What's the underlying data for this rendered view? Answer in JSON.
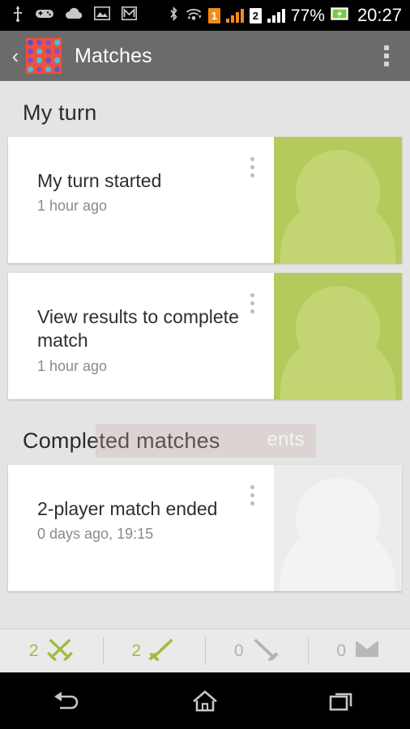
{
  "status_bar": {
    "left_icons": [
      "usb-icon",
      "gamepad-icon",
      "cloud-upload-icon",
      "image-icon",
      "gmail-icon"
    ],
    "bluetooth_icon": "bluetooth-icon",
    "wifi_icon": "wifi-icon",
    "sim1_label": "1",
    "sim2_label": "2",
    "battery_percent": "77%",
    "battery_icon": "battery-charging-icon",
    "clock": "20:27"
  },
  "app_bar": {
    "up_caret": "‹",
    "app_icon": "app-grid-dots-icon",
    "icon_bg": "#ef513c",
    "dot_colors": [
      "#5a4fd0",
      "#7b52c4",
      "#8b4fc0",
      "#3fc3e0",
      "#6a53cc",
      "#3fc3e0",
      "#7b52c4",
      "#8b4fc0",
      "#8b4fc0",
      "#3fc3e0",
      "#6a53cc",
      "#3fc3e0",
      "#3fc3e0",
      "#8b4fc0",
      "#3fc3e0",
      "#6a53cc"
    ],
    "title": "Matches",
    "overflow_icon": "overflow-menu-icon"
  },
  "sections": [
    {
      "title": "My turn",
      "cards": [
        {
          "title": "My turn started",
          "subtitle": "1 hour ago",
          "avatar_style": "green",
          "avatar_icon": "person-placeholder-icon",
          "menu_icon": "card-overflow-icon"
        },
        {
          "title": "View results to complete match",
          "subtitle": "1 hour ago",
          "avatar_style": "green",
          "avatar_icon": "person-placeholder-icon",
          "menu_icon": "card-overflow-icon"
        }
      ]
    },
    {
      "title": "Completed matches",
      "cards": [
        {
          "title": "2-player match ended",
          "subtitle": "0 days ago, 19:15",
          "avatar_style": "gray",
          "avatar_icon": "person-placeholder-icon",
          "menu_icon": "card-overflow-icon"
        }
      ]
    }
  ],
  "ghost_overlay": {
    "text": "ents",
    "color": "#c7afa8"
  },
  "tab_bar": {
    "accent_active": "#9ebd3f",
    "accent_inactive": "#b2b2b2",
    "tabs": [
      {
        "count": "2",
        "icon": "crossed-swords-icon",
        "state": "active"
      },
      {
        "count": "2",
        "icon": "sword-up-icon",
        "state": "active"
      },
      {
        "count": "0",
        "icon": "sword-down-icon",
        "state": "inactive"
      },
      {
        "count": "0",
        "icon": "envelope-icon",
        "state": "inactive"
      }
    ]
  },
  "nav_bar": {
    "back": "back-icon",
    "home": "home-icon",
    "recents": "recents-icon"
  }
}
